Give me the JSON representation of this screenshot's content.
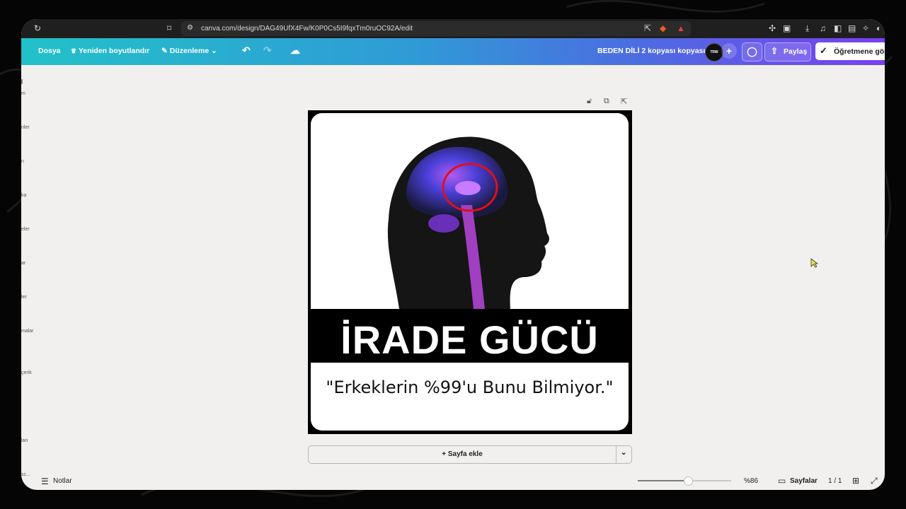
{
  "browser": {
    "url": "canva.com/design/DAG49UfX4Fw/K0P0Cs5I9fqxTm0ruOC92A/edit"
  },
  "toolbar": {
    "file": "Dosya",
    "resize": "Yeniden boyutlandır",
    "edit": "Düzenleme",
    "doc_title": "BEDEN DİLİ 2 kopyası kopyası",
    "share": "Paylaş",
    "teacher": "Öğretmene gön",
    "avatar_text": "TRW"
  },
  "sidebar": {
    "labels": [
      "m",
      "nler",
      "n",
      "ka",
      "eler",
      "ar",
      "ler",
      "malar",
      "çerik",
      "lan",
      "sc..."
    ]
  },
  "design": {
    "title": "İRADE GÜCÜ",
    "subtitle": "\"Erkeklerin %99'u Bunu Bilmiyor.\""
  },
  "canvas": {
    "add_page": "+ Sayfa ekle"
  },
  "footer": {
    "notes": "Notlar",
    "zoom": "%86",
    "zoom_level": 0.54,
    "pages_label": "Sayfalar",
    "page_count": "1 / 1"
  },
  "colors": {
    "toolbar_start": "#22c1c9",
    "toolbar_end": "#7a3ff0",
    "highlight_circle": "#e0101a"
  }
}
